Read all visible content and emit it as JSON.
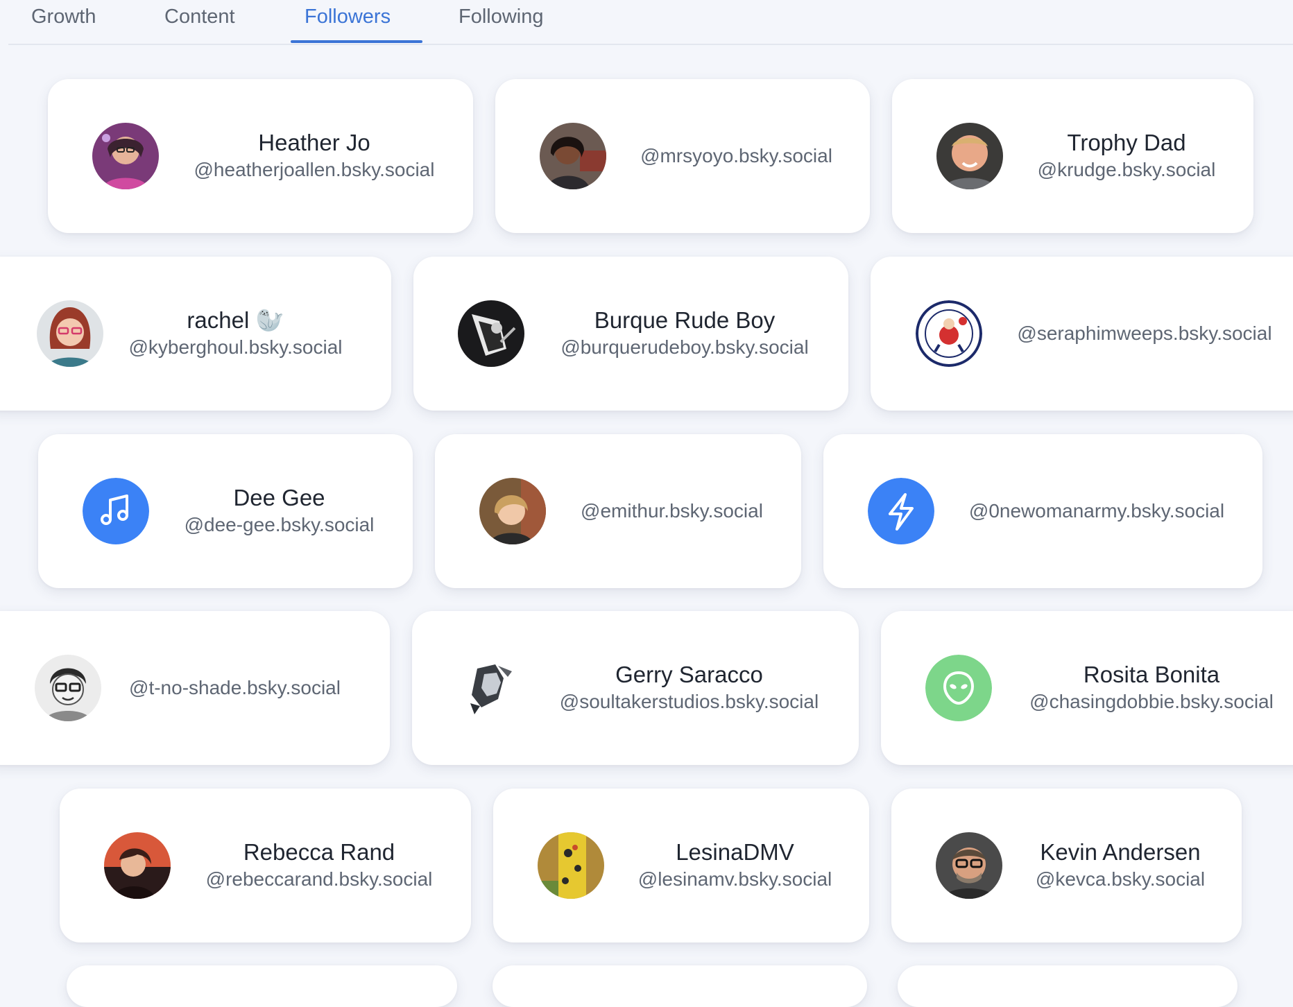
{
  "tabs": [
    {
      "label": "Growth"
    },
    {
      "label": "Content"
    },
    {
      "label": "Followers"
    },
    {
      "label": "Following"
    }
  ],
  "active_tab": "Followers",
  "colors": {
    "accent": "#3b74d6",
    "music_avatar": "#3b82f6",
    "bolt_avatar": "#3b82f6",
    "alien_avatar": "#7dd68a"
  },
  "followers": [
    {
      "name": "Heather Jo",
      "handle": "@heatherjoallen.bsky.social",
      "avatar": "photo-avatar"
    },
    {
      "name": "",
      "handle": "@mrsyoyo.bsky.social",
      "avatar": "photo-avatar"
    },
    {
      "name": "Trophy Dad",
      "handle": "@krudge.bsky.social",
      "avatar": "photo-avatar"
    },
    {
      "name": "rachel 🦭",
      "handle": "@kyberghoul.bsky.social",
      "avatar": "illustrated-avatar"
    },
    {
      "name": "Burque Rude Boy",
      "handle": "@burquerudeboy.bsky.social",
      "avatar": "photo-avatar"
    },
    {
      "name": "",
      "handle": "@seraphimweeps.bsky.social",
      "avatar": "denver-nuggets-logo"
    },
    {
      "name": "Dee Gee",
      "handle": "@dee-gee.bsky.social",
      "avatar": "music-note-icon"
    },
    {
      "name": "",
      "handle": "@emithur.bsky.social",
      "avatar": "photo-avatar"
    },
    {
      "name": "",
      "handle": "@0newomanarmy.bsky.social",
      "avatar": "lightning-bolt-icon"
    },
    {
      "name": "",
      "handle": "@t-no-shade.bsky.social",
      "avatar": "cartoon-avatar"
    },
    {
      "name": "Gerry Saracco",
      "handle": "@soultakerstudios.bsky.social",
      "avatar": "comic-avatar"
    },
    {
      "name": "Rosita Bonita",
      "handle": "@chasingdobbie.bsky.social",
      "avatar": "alien-icon"
    },
    {
      "name": "Rebecca Rand",
      "handle": "@rebeccarand.bsky.social",
      "avatar": "photo-avatar"
    },
    {
      "name": "LesinaDMV",
      "handle": "@lesinamv.bsky.social",
      "avatar": "painting-avatar"
    },
    {
      "name": "Kevin Andersen",
      "handle": "@kevca.bsky.social",
      "avatar": "photo-avatar"
    }
  ]
}
